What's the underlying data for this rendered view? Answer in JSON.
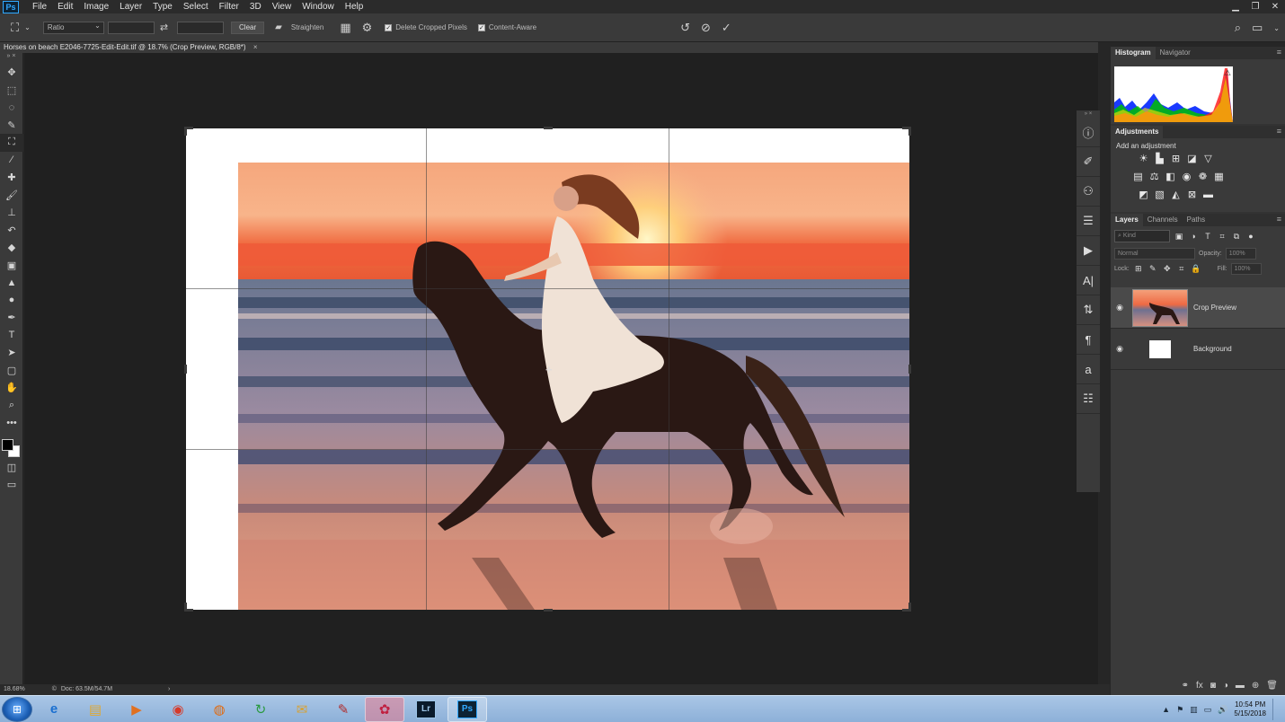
{
  "app": {
    "logo": "Ps",
    "menu": [
      "File",
      "Edit",
      "Image",
      "Layer",
      "Type",
      "Select",
      "Filter",
      "3D",
      "View",
      "Window",
      "Help"
    ]
  },
  "options": {
    "ratio": "Ratio",
    "clear": "Clear",
    "straighten": "Straighten",
    "delete_cropped": "Delete Cropped Pixels",
    "content_aware": "Content-Aware"
  },
  "document": {
    "tab_title": "Horses on beach E2046-7725-Edit-Edit.tif @ 18.7% (Crop Preview, RGB/8*)",
    "close": "×"
  },
  "status": {
    "zoom": "18.68%",
    "doc_info": "Doc: 63.5M/54.7M",
    "arrow": "›"
  },
  "panels": {
    "histogram_tab": "Histogram",
    "navigator_tab": "Navigator",
    "adjustments_tab": "Adjustments",
    "add_adjustment": "Add an adjustment",
    "layers_tab": "Layers",
    "channels_tab": "Channels",
    "paths_tab": "Paths",
    "kind": "Kind",
    "blend_mode": "Normal",
    "opacity_label": "Opacity:",
    "opacity_value": "100%",
    "lock_label": "Lock:",
    "fill_label": "Fill:",
    "fill_value": "100%"
  },
  "layers": [
    {
      "name": "Crop Preview",
      "visible": true,
      "selected": true
    },
    {
      "name": "Background",
      "visible": true,
      "selected": false
    }
  ],
  "taskbar": {
    "lr": "Lr",
    "ps": "Ps",
    "time": "10:54 PM",
    "date": "5/15/2018"
  }
}
